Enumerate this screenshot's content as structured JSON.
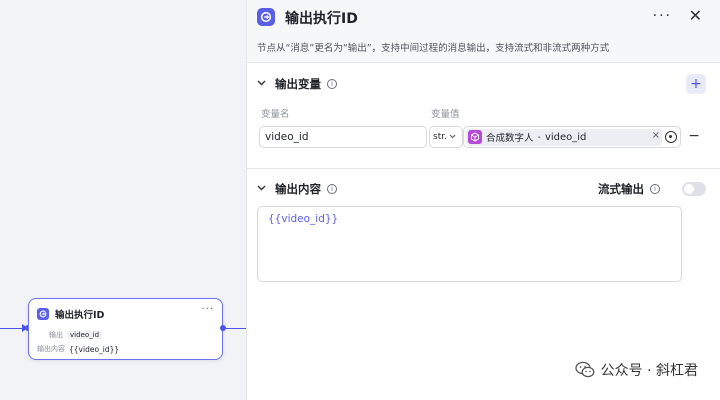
{
  "node": {
    "title": "输出执行ID",
    "more": "···",
    "output_label": "输出",
    "output_chip": "video_id",
    "content_label": "输出内容",
    "content_value": "{{video_id}}"
  },
  "panel": {
    "title": "输出执行ID",
    "description": "节点从“消息”更名为“输出”，支持中间过程的消息输出，支持流式和非流式两种方式",
    "more": "···",
    "close": "✕"
  },
  "output_vars": {
    "title": "输出变量",
    "name_label": "变量名",
    "value_label": "变量值",
    "add": "+",
    "remove": "−",
    "rows": [
      {
        "name": "video_id",
        "type": "str.",
        "ref_source": "合成数字人",
        "ref_sep": "-",
        "ref_var": "video_id",
        "clear": "×"
      }
    ]
  },
  "output_content": {
    "title": "输出内容",
    "stream_label": "流式输出",
    "stream_on": false,
    "value": "{{video_id}}"
  },
  "watermark": {
    "text": "公众号 · 斜杠君"
  },
  "colors": {
    "accent": "#4d53e8",
    "node_icon": "#5a5fe8",
    "ref_icon": "#b44ad6"
  }
}
